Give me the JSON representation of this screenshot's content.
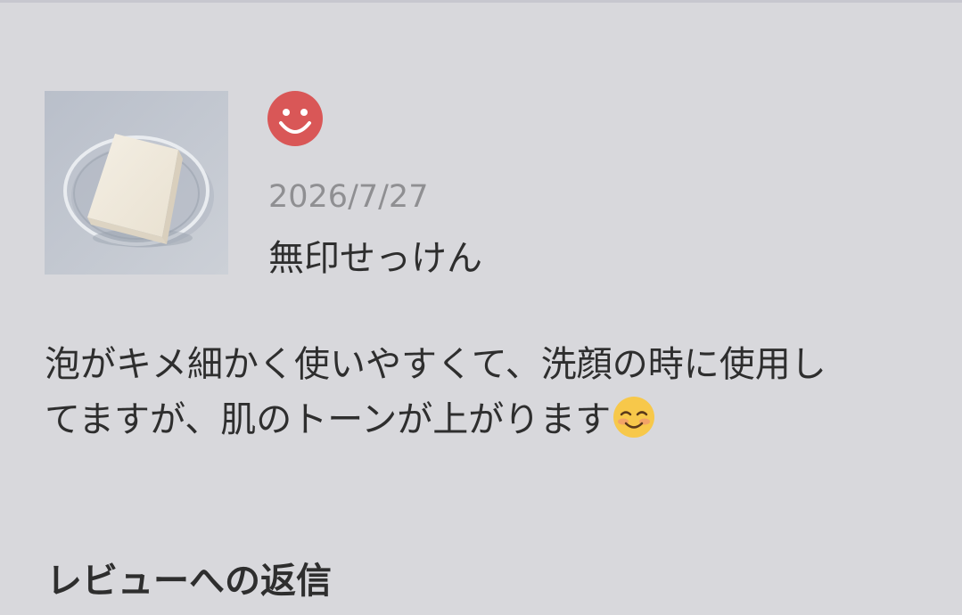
{
  "review": {
    "rating_icon": "smiling-face-icon",
    "rating_color": "#d95757",
    "date": "2026/7/27",
    "product_name": "無印せっけん",
    "thumbnail_icon": "soap-bar-in-glass-dish-photo",
    "body_lines": [
      "泡がキメ細かく使いやすくて、洗顔の時に使用し",
      "てますが、肌のトーンが上がります"
    ],
    "body_emoji": "smiling-face-with-blush-emoji"
  },
  "reply_section": {
    "heading": "レビューへの返信"
  },
  "colors": {
    "background": "#d8d8dc",
    "date_text": "#8f8f92",
    "body_text": "#2e2e2e"
  }
}
